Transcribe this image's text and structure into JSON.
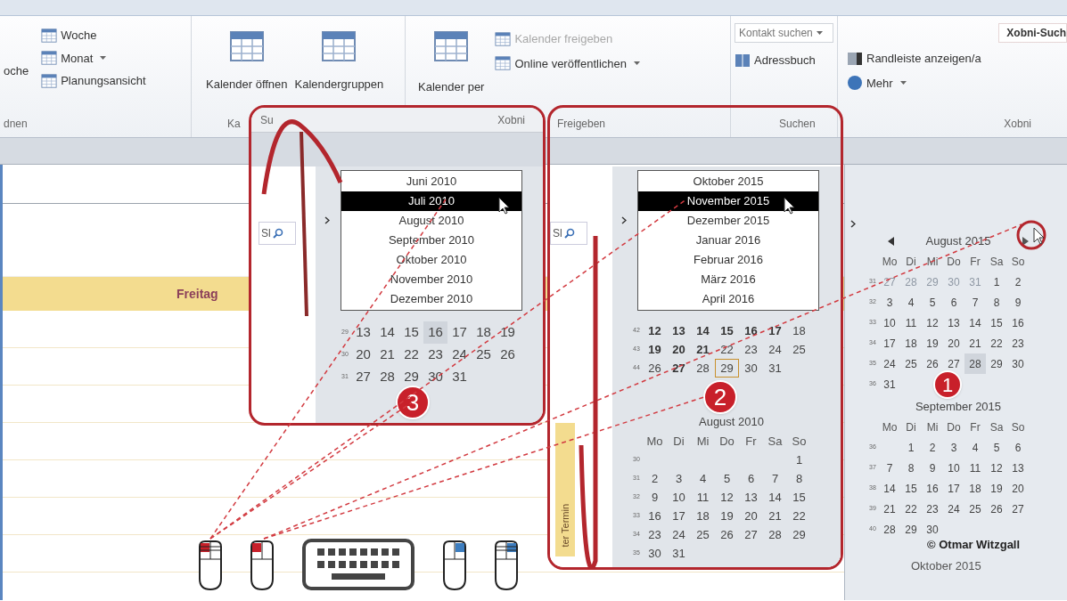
{
  "ribbon": {
    "view_group": {
      "cut_button": "oche",
      "items": [
        {
          "label": "Woche",
          "dropdown": false
        },
        {
          "label": "Monat",
          "dropdown": true
        },
        {
          "label": "Planungsansicht",
          "dropdown": false
        }
      ],
      "label": "dnen"
    },
    "manage_group": {
      "buttons": [
        "Kalender öffnen",
        "Kalendergruppen"
      ],
      "label": "Ka"
    },
    "share_group": {
      "big_button": "Kalender per",
      "items": [
        {
          "label": "Kalender freigeben",
          "disabled": true,
          "dropdown": false
        },
        {
          "label": "Online veröffentlichen",
          "disabled": false,
          "dropdown": true
        }
      ],
      "label": "Freigeben"
    },
    "search_group": {
      "field": "Kontakt suchen",
      "button": "Adressbuch",
      "label": "Suchen"
    },
    "xobni_group": {
      "field": "Xobni-Such",
      "items": [
        {
          "label": "Randleiste anzeigen/a",
          "dropdown": false
        },
        {
          "label": "Mehr",
          "dropdown": true
        }
      ],
      "label": "Xobni"
    }
  },
  "day_view": {
    "day": "Freitag"
  },
  "inset_3": {
    "badge": "3",
    "header_labels": [
      "Su",
      "Xobni"
    ],
    "search_fragment": "Sl",
    "months": [
      {
        "label": "Juni 2010",
        "selected": false
      },
      {
        "label": "Juli 2010",
        "selected": true
      },
      {
        "label": "August 2010",
        "selected": false
      },
      {
        "label": "September 2010",
        "selected": false
      },
      {
        "label": "Oktober 2010",
        "selected": false
      },
      {
        "label": "November 2010",
        "selected": false
      },
      {
        "label": "Dezember 2010",
        "selected": false
      }
    ],
    "weeks": [
      {
        "week": "29",
        "days": [
          {
            "d": "13",
            "kind": "plain"
          },
          {
            "d": "14",
            "kind": "plain"
          },
          {
            "d": "15",
            "kind": "plain"
          },
          {
            "d": "16",
            "kind": "shaded"
          },
          {
            "d": "17",
            "kind": "plain"
          },
          {
            "d": "18",
            "kind": "plain"
          },
          {
            "d": "19",
            "kind": "plain"
          }
        ]
      },
      {
        "week": "30",
        "days": [
          {
            "d": "20",
            "kind": "plain"
          },
          {
            "d": "21",
            "kind": "plain"
          },
          {
            "d": "22",
            "kind": "plain"
          },
          {
            "d": "23",
            "kind": "plain"
          },
          {
            "d": "24",
            "kind": "plain"
          },
          {
            "d": "25",
            "kind": "plain"
          },
          {
            "d": "26",
            "kind": "plain"
          }
        ]
      },
      {
        "week": "31",
        "right_aligned": false,
        "days": [
          {
            "d": "27",
            "kind": "plain"
          },
          {
            "d": "28",
            "kind": "plain"
          },
          {
            "d": "29",
            "kind": "plain"
          },
          {
            "d": "30",
            "kind": "plain"
          },
          {
            "d": "31",
            "kind": "plain"
          }
        ]
      }
    ]
  },
  "inset_2": {
    "badge": "2",
    "search_fragment": "Sl",
    "strip_label": "ter Termin",
    "months": [
      {
        "label": "Oktober 2015",
        "selected": false
      },
      {
        "label": "November 2015",
        "selected": true
      },
      {
        "label": "Dezember 2015",
        "selected": false
      },
      {
        "label": "Januar 2016",
        "selected": false
      },
      {
        "label": "Februar 2016",
        "selected": false
      },
      {
        "label": "März 2016",
        "selected": false
      },
      {
        "label": "April 2016",
        "selected": false
      }
    ],
    "weeks": [
      {
        "week": "42",
        "days": [
          {
            "d": "12",
            "kind": "bold"
          },
          {
            "d": "13",
            "kind": "bold"
          },
          {
            "d": "14",
            "kind": "bold"
          },
          {
            "d": "15",
            "kind": "bold"
          },
          {
            "d": "16",
            "kind": "bold"
          },
          {
            "d": "17",
            "kind": "bold"
          },
          {
            "d": "18",
            "kind": "plain"
          }
        ]
      },
      {
        "week": "43",
        "days": [
          {
            "d": "19",
            "kind": "bold"
          },
          {
            "d": "20",
            "kind": "bold"
          },
          {
            "d": "21",
            "kind": "bold"
          },
          {
            "d": "22",
            "kind": "plain"
          },
          {
            "d": "23",
            "kind": "plain"
          },
          {
            "d": "24",
            "kind": "plain"
          },
          {
            "d": "25",
            "kind": "plain"
          }
        ]
      },
      {
        "week": "44",
        "right_aligned": false,
        "days": [
          {
            "d": "26",
            "kind": "plain"
          },
          {
            "d": "27",
            "kind": "bold"
          },
          {
            "d": "28",
            "kind": "plain"
          },
          {
            "d": "29",
            "kind": "boxed"
          },
          {
            "d": "30",
            "kind": "plain"
          },
          {
            "d": "31",
            "kind": "plain"
          }
        ]
      }
    ],
    "month": {
      "title": "August 2010",
      "weekdays": [
        "Mo",
        "Di",
        "Mi",
        "Do",
        "Fr",
        "Sa",
        "So"
      ],
      "weeks": [
        {
          "week": "30",
          "right_aligned": true,
          "days": [
            {
              "d": "1",
              "kind": "plain"
            }
          ]
        },
        {
          "week": "31",
          "days": [
            {
              "d": "2",
              "kind": "plain"
            },
            {
              "d": "3",
              "kind": "plain"
            },
            {
              "d": "4",
              "kind": "plain"
            },
            {
              "d": "5",
              "kind": "plain"
            },
            {
              "d": "6",
              "kind": "plain"
            },
            {
              "d": "7",
              "kind": "plain"
            },
            {
              "d": "8",
              "kind": "plain"
            }
          ]
        },
        {
          "week": "32",
          "days": [
            {
              "d": "9",
              "kind": "plain"
            },
            {
              "d": "10",
              "kind": "plain"
            },
            {
              "d": "11",
              "kind": "plain"
            },
            {
              "d": "12",
              "kind": "plain"
            },
            {
              "d": "13",
              "kind": "plain"
            },
            {
              "d": "14",
              "kind": "plain"
            },
            {
              "d": "15",
              "kind": "plain"
            }
          ]
        },
        {
          "week": "33",
          "days": [
            {
              "d": "16",
              "kind": "plain"
            },
            {
              "d": "17",
              "kind": "plain"
            },
            {
              "d": "18",
              "kind": "plain"
            },
            {
              "d": "19",
              "kind": "plain"
            },
            {
              "d": "20",
              "kind": "plain"
            },
            {
              "d": "21",
              "kind": "plain"
            },
            {
              "d": "22",
              "kind": "plain"
            }
          ]
        },
        {
          "week": "34",
          "days": [
            {
              "d": "23",
              "kind": "plain"
            },
            {
              "d": "24",
              "kind": "plain"
            },
            {
              "d": "25",
              "kind": "plain"
            },
            {
              "d": "26",
              "kind": "plain"
            },
            {
              "d": "27",
              "kind": "plain"
            },
            {
              "d": "28",
              "kind": "plain"
            },
            {
              "d": "29",
              "kind": "plain"
            }
          ]
        },
        {
          "week": "35",
          "right_aligned": false,
          "days": [
            {
              "d": "30",
              "kind": "plain"
            },
            {
              "d": "31",
              "kind": "plain"
            }
          ]
        }
      ]
    }
  },
  "navigator": {
    "badge": "1",
    "months": [
      {
        "title": "August 2015",
        "weekdays": [
          "Mo",
          "Di",
          "Mi",
          "Do",
          "Fr",
          "Sa",
          "So"
        ],
        "weeks": [
          {
            "week": "31",
            "days": [
              {
                "d": "27",
                "kind": "faded"
              },
              {
                "d": "28",
                "kind": "faded"
              },
              {
                "d": "29",
                "kind": "faded"
              },
              {
                "d": "30",
                "kind": "faded"
              },
              {
                "d": "31",
                "kind": "faded"
              },
              {
                "d": "1",
                "kind": "plain"
              },
              {
                "d": "2",
                "kind": "plain"
              }
            ]
          },
          {
            "week": "32",
            "days": [
              {
                "d": "3",
                "kind": "plain"
              },
              {
                "d": "4",
                "kind": "plain"
              },
              {
                "d": "5",
                "kind": "plain"
              },
              {
                "d": "6",
                "kind": "plain"
              },
              {
                "d": "7",
                "kind": "plain"
              },
              {
                "d": "8",
                "kind": "plain"
              },
              {
                "d": "9",
                "kind": "plain"
              }
            ]
          },
          {
            "week": "33",
            "days": [
              {
                "d": "10",
                "kind": "plain"
              },
              {
                "d": "11",
                "kind": "plain"
              },
              {
                "d": "12",
                "kind": "plain"
              },
              {
                "d": "13",
                "kind": "plain"
              },
              {
                "d": "14",
                "kind": "plain"
              },
              {
                "d": "15",
                "kind": "plain"
              },
              {
                "d": "16",
                "kind": "plain"
              }
            ]
          },
          {
            "week": "34",
            "days": [
              {
                "d": "17",
                "kind": "plain"
              },
              {
                "d": "18",
                "kind": "plain"
              },
              {
                "d": "19",
                "kind": "plain"
              },
              {
                "d": "20",
                "kind": "plain"
              },
              {
                "d": "21",
                "kind": "plain"
              },
              {
                "d": "22",
                "kind": "plain"
              },
              {
                "d": "23",
                "kind": "plain"
              }
            ]
          },
          {
            "week": "35",
            "days": [
              {
                "d": "24",
                "kind": "plain"
              },
              {
                "d": "25",
                "kind": "plain"
              },
              {
                "d": "26",
                "kind": "plain"
              },
              {
                "d": "27",
                "kind": "plain"
              },
              {
                "d": "28",
                "kind": "shaded"
              },
              {
                "d": "29",
                "kind": "plain"
              },
              {
                "d": "30",
                "kind": "plain"
              }
            ]
          },
          {
            "week": "36",
            "right_aligned": false,
            "days": [
              {
                "d": "31",
                "kind": "plain"
              }
            ]
          }
        ]
      },
      {
        "title": "September 2015",
        "weekdays": [
          "Mo",
          "Di",
          "Mi",
          "Do",
          "Fr",
          "Sa",
          "So"
        ],
        "weeks": [
          {
            "week": "36",
            "right_aligned": true,
            "days": [
              {
                "d": "1",
                "kind": "plain"
              },
              {
                "d": "2",
                "kind": "plain"
              },
              {
                "d": "3",
                "kind": "plain"
              },
              {
                "d": "4",
                "kind": "plain"
              },
              {
                "d": "5",
                "kind": "plain"
              },
              {
                "d": "6",
                "kind": "plain"
              }
            ]
          },
          {
            "week": "37",
            "days": [
              {
                "d": "7",
                "kind": "plain"
              },
              {
                "d": "8",
                "kind": "plain"
              },
              {
                "d": "9",
                "kind": "plain"
              },
              {
                "d": "10",
                "kind": "plain"
              },
              {
                "d": "11",
                "kind": "plain"
              },
              {
                "d": "12",
                "kind": "plain"
              },
              {
                "d": "13",
                "kind": "plain"
              }
            ]
          },
          {
            "week": "38",
            "days": [
              {
                "d": "14",
                "kind": "plain"
              },
              {
                "d": "15",
                "kind": "plain"
              },
              {
                "d": "16",
                "kind": "plain"
              },
              {
                "d": "17",
                "kind": "plain"
              },
              {
                "d": "18",
                "kind": "plain"
              },
              {
                "d": "19",
                "kind": "plain"
              },
              {
                "d": "20",
                "kind": "plain"
              }
            ]
          },
          {
            "week": "39",
            "days": [
              {
                "d": "21",
                "kind": "plain"
              },
              {
                "d": "22",
                "kind": "plain"
              },
              {
                "d": "23",
                "kind": "plain"
              },
              {
                "d": "24",
                "kind": "plain"
              },
              {
                "d": "25",
                "kind": "plain"
              },
              {
                "d": "26",
                "kind": "plain"
              },
              {
                "d": "27",
                "kind": "plain"
              }
            ]
          },
          {
            "week": "40",
            "right_aligned": false,
            "days": [
              {
                "d": "28",
                "kind": "plain"
              },
              {
                "d": "29",
                "kind": "plain"
              },
              {
                "d": "30",
                "kind": "plain"
              }
            ]
          }
        ]
      }
    ],
    "next_month_title": "Oktober 2015",
    "copyright": "© Otmar Witzgall"
  }
}
